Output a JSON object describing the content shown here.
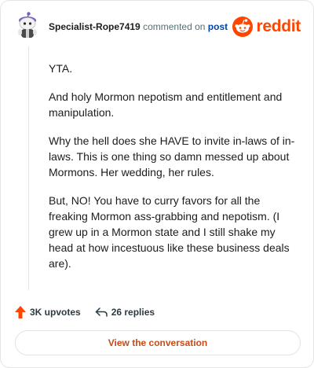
{
  "header": {
    "username": "Specialist-Rope7419",
    "action_text": "commented on",
    "post_link": "post",
    "brand": "reddit"
  },
  "comment": {
    "paragraphs": [
      "YTA.",
      "And holy Mormon nepotism and entitlement and manipulation.",
      "Why the hell does she HAVE to invite in-laws of in-laws. This is one thing so damn messed up about Mormons. Her wedding, her rules.",
      "But, NO! You have to curry favors for all the freaking Mormon ass-grabbing and nepotism. (I grew up in a Mormon state and I still shake my head at how incestuous like these business deals are)."
    ]
  },
  "actions": {
    "upvotes": "3K upvotes",
    "replies": "26 replies",
    "upvote_icon": "upvote-arrow-icon",
    "reply_icon": "reply-arrow-icon"
  },
  "footer": {
    "view_button": "View the conversation"
  },
  "colors": {
    "brand": "#ff4500",
    "upvote": "#ff4500",
    "link": "#0045ac",
    "view_button_text": "#c64b17"
  }
}
